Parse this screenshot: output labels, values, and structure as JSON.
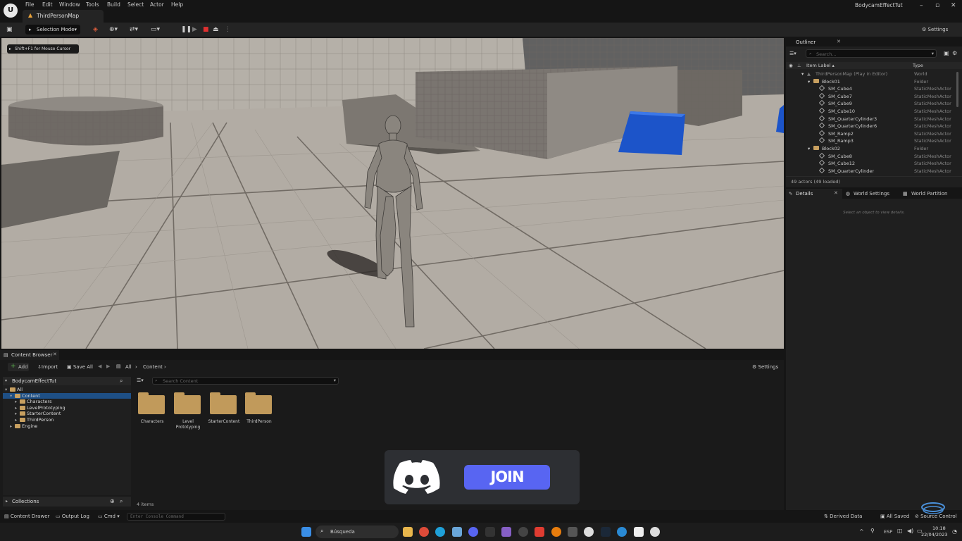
{
  "menu": [
    "File",
    "Edit",
    "Window",
    "Tools",
    "Build",
    "Select",
    "Actor",
    "Help"
  ],
  "map_tab": "ThirdPersonMap",
  "project_name": "BodycamEffectTut",
  "window_controls": [
    "–",
    "▫",
    "✕"
  ],
  "toolbar": {
    "selection_mode": "Selection Mode",
    "settings": "Settings"
  },
  "viewport": {
    "hint": "Shift+F1 for Mouse Cursor"
  },
  "outliner": {
    "title": "Outliner",
    "search_placeholder": "Search...",
    "col_label": "Item Label ▴",
    "col_type": "Type",
    "rows": [
      {
        "label": "ThirdPersonMap (Play in Editor)",
        "type": "World"
      },
      {
        "label": "Block01",
        "type": "Folder"
      },
      {
        "label": "SM_Cube4",
        "type": "StaticMeshActor"
      },
      {
        "label": "SM_Cube7",
        "type": "StaticMeshActor"
      },
      {
        "label": "SM_Cube9",
        "type": "StaticMeshActor"
      },
      {
        "label": "SM_Cube10",
        "type": "StaticMeshActor"
      },
      {
        "label": "SM_QuarterCylinder3",
        "type": "StaticMeshActor"
      },
      {
        "label": "SM_QuarterCylinder6",
        "type": "StaticMeshActor"
      },
      {
        "label": "SM_Ramp2",
        "type": "StaticMeshActor"
      },
      {
        "label": "SM_Ramp3",
        "type": "StaticMeshActor"
      },
      {
        "label": "Block02",
        "type": "Folder"
      },
      {
        "label": "SM_Cube8",
        "type": "StaticMeshActor"
      },
      {
        "label": "SM_Cube12",
        "type": "StaticMeshActor"
      },
      {
        "label": "SM_QuarterCylinder",
        "type": "StaticMeshActor"
      }
    ],
    "footer": "49 actors (49 loaded)"
  },
  "details": {
    "tabs": [
      "Details",
      "World Settings",
      "World Partition"
    ],
    "empty_message": "Select an object to view details."
  },
  "content_browser": {
    "tab": "Content Browser",
    "add": "Add",
    "import": "Import",
    "save_all": "Save All",
    "breadcrumb": [
      "All",
      "Content"
    ],
    "settings": "Settings",
    "project_root": "BodycamEffectTut",
    "tree": [
      "All",
      "Content",
      "Characters",
      "LevelPrototyping",
      "StarterContent",
      "ThirdPerson",
      "Engine"
    ],
    "search_placeholder": "Search Content",
    "folders": [
      "Characters",
      "Level Prototyping",
      "StarterContent",
      "ThirdPerson"
    ],
    "collections": "Collections",
    "item_count": "4 items"
  },
  "statusbar": {
    "content_drawer": "Content Drawer",
    "output_log": "Output Log",
    "cmd": "Cmd",
    "console_placeholder": "Enter Console Command",
    "derived_data": "Derived Data",
    "all_saved": "All Saved",
    "source_control": "Source Control"
  },
  "overlay": {
    "join": "JOIN"
  },
  "taskbar": {
    "search": "Búsqueda",
    "lang": "ESP",
    "time": "10:18",
    "date": "22/04/2023"
  }
}
